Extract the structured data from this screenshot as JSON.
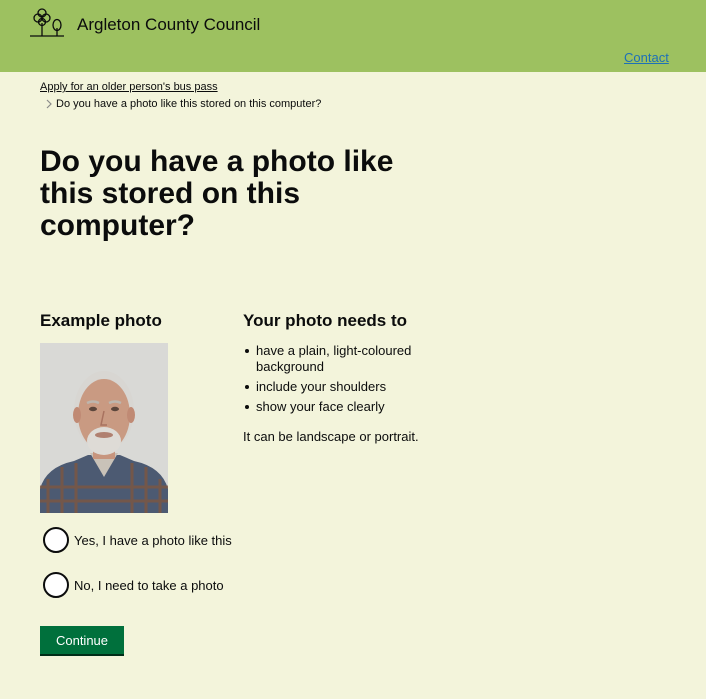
{
  "header": {
    "council_name": "Argleton County Council",
    "contact_label": "Contact",
    "logo_icon": "tree-logo-icon"
  },
  "breadcrumb": {
    "parent_label": "Apply for an older person's bus pass",
    "current_label": "Do you have a photo like this stored on this computer?"
  },
  "page": {
    "title": "Do you have a photo like this stored on this computer?"
  },
  "example": {
    "heading": "Example photo"
  },
  "requirements": {
    "heading": "Your photo needs to",
    "items": [
      "have a plain, light-coloured background",
      "include your shoulders",
      "show your face clearly"
    ],
    "note": "It can be landscape or portrait."
  },
  "options": [
    {
      "label": "Yes, I have a photo like this",
      "selected": false
    },
    {
      "label": "No, I need to take a photo",
      "selected": false
    }
  ],
  "actions": {
    "continue_label": "Continue"
  },
  "colors": {
    "header_background": "#9dc160",
    "page_background": "#f3f4db",
    "link": "#1d70b8",
    "button": "#00703c"
  }
}
